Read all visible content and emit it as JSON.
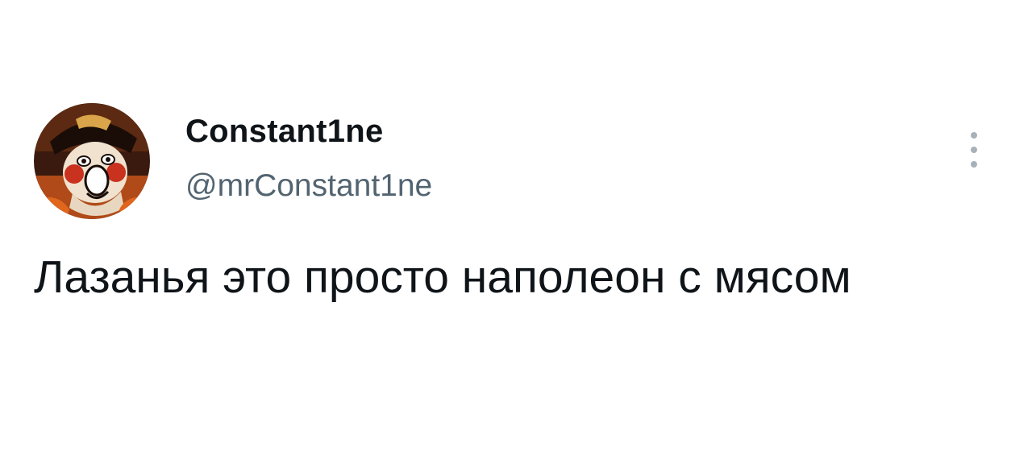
{
  "tweet": {
    "author": {
      "display_name": "Constant1ne",
      "handle": "@mrConstant1ne",
      "avatar_icon": "cartoon-pirate-avatar"
    },
    "more_icon": "more-vertical-icon",
    "text": "Лазанья это просто наполеон с мясом"
  },
  "colors": {
    "background": "#ffffff",
    "primary_text": "#0f1419",
    "secondary_text": "#536471",
    "icon_gray": "#a7b1b9"
  }
}
